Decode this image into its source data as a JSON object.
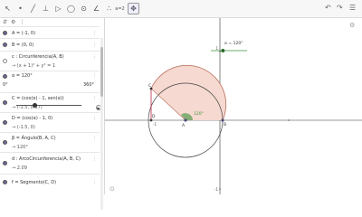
{
  "toolbar": {
    "tools": [
      "pointer-tool",
      "point-tool",
      "line-tool",
      "perpendicular-tool",
      "polygon-tool",
      "circle-tool",
      "ellipse-tool",
      "angle-tool",
      "reflect-tool",
      "slider-tool",
      "move-graphics-tool"
    ],
    "glyphs": [
      "↖",
      "•",
      "╱",
      "⊥",
      "▷",
      "◯",
      "⊙",
      "∠",
      "∴",
      "a=2",
      "✥"
    ]
  },
  "algebra": {
    "items": [
      {
        "def": "A = (-1, 0)"
      },
      {
        "def": "B = (0, 0)"
      },
      {
        "def": "c : Circunferencia(A, B)",
        "res": "→  (x + 1)² + y² = 1"
      },
      {
        "def": "α = 120°",
        "min": "0°",
        "max": "360°"
      },
      {
        "def": "C = (cos(α) - 1, sen(α))",
        "res": "→  (-1.5, 0.87)"
      },
      {
        "def": "D = (cos(α) - 1, 0)",
        "res": "→  (-1.5, 0)"
      },
      {
        "def": "β = Ángulo(B, A, C)",
        "res": "→  120°"
      },
      {
        "def": "d : ArcoCircunferencia(A, B, C)",
        "res": "→  2.09"
      },
      {
        "def": "f = Segmento(C, D)"
      }
    ]
  },
  "graphics": {
    "slider_label": "α = 120°",
    "label_C": "C",
    "label_D": "D",
    "label_A": "A",
    "label_B": "B",
    "angle_label": "120°",
    "slider_level": 0.333
  }
}
